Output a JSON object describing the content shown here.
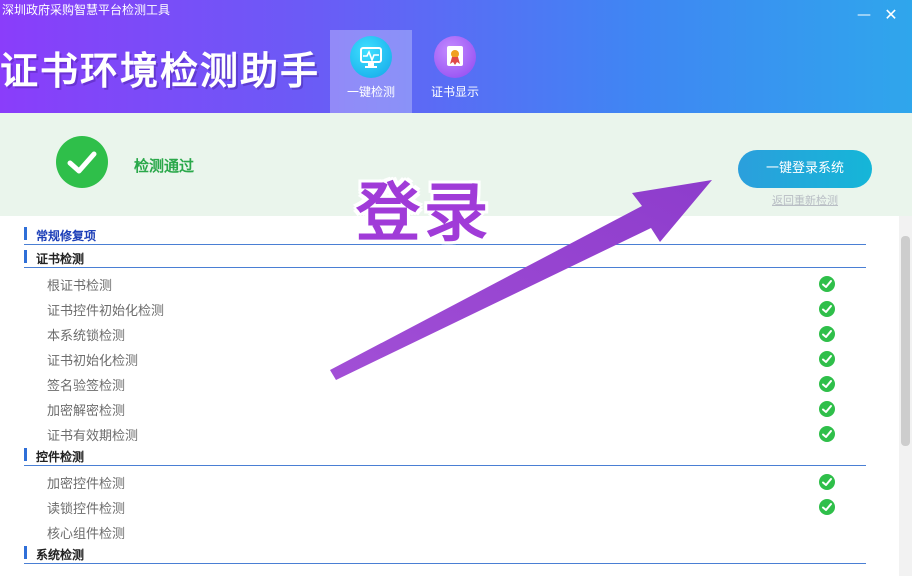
{
  "window": {
    "title": "深圳政府采购智慧平台检测工具",
    "minimize_glyph": "—",
    "close_glyph": "✕"
  },
  "brand": "证书环境检测助手",
  "tabs": [
    {
      "label": "一键检测",
      "icon": "monitor-icon",
      "active": true
    },
    {
      "label": "证书显示",
      "icon": "certificate-icon",
      "active": false
    }
  ],
  "status": {
    "text": "检测通过",
    "login_button": "一键登录系统",
    "redetect_link": "返回重新检测"
  },
  "annotation": {
    "text": "登录",
    "color": "#a03bd8"
  },
  "sections": [
    {
      "title": "常规修复项",
      "items": []
    },
    {
      "title": "证书检测",
      "items": [
        {
          "label": "根证书检测",
          "ok": true
        },
        {
          "label": "证书控件初始化检测",
          "ok": true
        },
        {
          "label": "本系统锁检测",
          "ok": true
        },
        {
          "label": "证书初始化检测",
          "ok": true
        },
        {
          "label": "签名验签检测",
          "ok": true
        },
        {
          "label": "加密解密检测",
          "ok": true
        },
        {
          "label": "证书有效期检测",
          "ok": true
        }
      ]
    },
    {
      "title": "控件检测",
      "items": [
        {
          "label": "加密控件检测",
          "ok": true
        },
        {
          "label": "读锁控件检测",
          "ok": true
        },
        {
          "label": "核心组件检测",
          "ok": false
        }
      ]
    },
    {
      "title": "系统检测",
      "items": []
    }
  ],
  "colors": {
    "success": "#2fbf4a",
    "accent_blue": "#1d3fb8",
    "button": "#1aa8dc"
  }
}
